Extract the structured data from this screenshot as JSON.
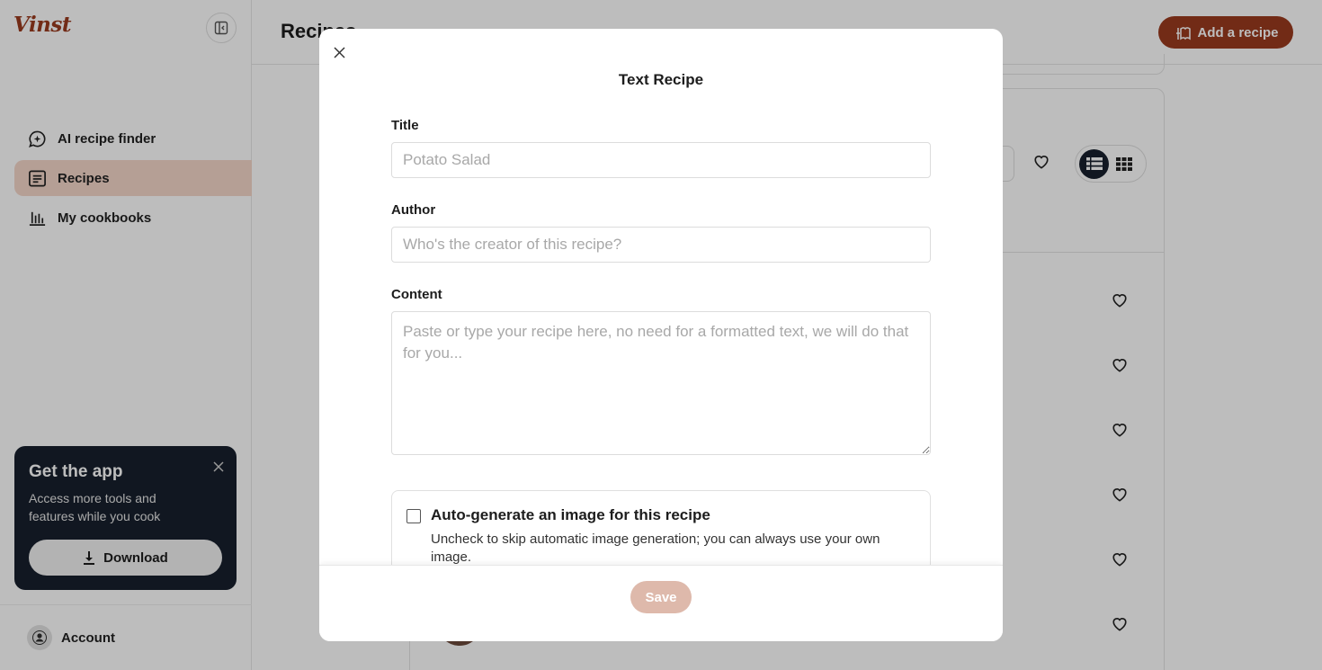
{
  "app": {
    "logo_text": "Vinst",
    "brand_color": "#9a3a1e"
  },
  "sidebar": {
    "items": [
      {
        "label": "AI recipe finder",
        "icon": "chat-sparkle-icon",
        "active": false
      },
      {
        "label": "Recipes",
        "icon": "recipe-book-icon",
        "active": true
      },
      {
        "label": "My cookbooks",
        "icon": "bar-chart-icon",
        "active": false
      }
    ],
    "promo": {
      "title": "Get the app",
      "text": "Access more tools and features while you cook",
      "download_label": "Download"
    },
    "account_label": "Account"
  },
  "header": {
    "title": "Recipes",
    "add_button_label": "Add a recipe"
  },
  "modal": {
    "title": "Text Recipe",
    "fields": {
      "title": {
        "label": "Title",
        "placeholder": "Potato Salad",
        "value": ""
      },
      "author": {
        "label": "Author",
        "placeholder": "Who's the creator of this recipe?",
        "value": ""
      },
      "content": {
        "label": "Content",
        "placeholder": "Paste or type your recipe here, no need for a formatted text, we will do that for you...",
        "value": ""
      }
    },
    "autogen": {
      "label": "Auto-generate an image for this recipe",
      "description": "Uncheck to skip automatic image generation; you can always use your own image.",
      "checked": false
    },
    "save_label": "Save"
  }
}
